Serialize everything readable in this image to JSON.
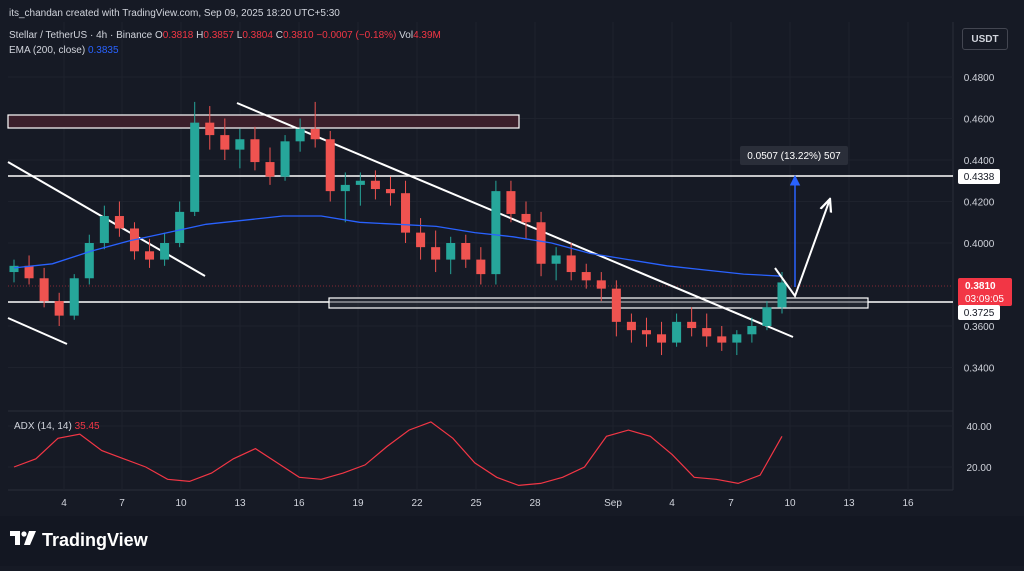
{
  "attribution": "its_chandan created with TradingView.com, Sep 09, 2025 18:20 UTC+5:30",
  "symbol": {
    "name": "Stellar / TetherUS · 4h · Binance",
    "open_label": "O",
    "open": "0.3818",
    "high_label": "H",
    "high": "0.3857",
    "low_label": "L",
    "low": "0.3804",
    "close_label": "C",
    "close": "0.3810",
    "change": "−0.0007 (−0.18%)",
    "vol_label": "Vol",
    "vol": "4.39M"
  },
  "ema": {
    "label": "EMA (200, close)",
    "value": "0.3835"
  },
  "currency_button": "USDT",
  "adx": {
    "label": "ADX (14, 14)",
    "value": "35.45"
  },
  "brand": {
    "logo_text": "TradingView"
  },
  "colors": {
    "background": "#161a25",
    "up": "#26a69a",
    "down": "#ef5350",
    "ema": "#2962ff",
    "adx": "#f23645",
    "white_lines": "#ffffff",
    "resistance_zone": "#3b1f2b"
  },
  "chart_data": {
    "type": "candlestick",
    "y_axis": {
      "ticks": [
        "0.4800",
        "0.4600",
        "0.4400",
        "0.4200",
        "0.4000",
        "0.3600",
        "0.3400"
      ],
      "range": [
        0.33,
        0.49
      ]
    },
    "x_axis": {
      "ticks": [
        "4",
        "7",
        "10",
        "13",
        "16",
        "19",
        "22",
        "25",
        "28",
        "Sep",
        "4",
        "7",
        "10",
        "13",
        "16"
      ]
    },
    "price_labels": {
      "last_price": "0.3810",
      "countdown": "03:09:05",
      "resistance": "0.4338",
      "support": "0.3725"
    },
    "measure": {
      "label": "0.0507 (13.22%) 507",
      "from": 0.381,
      "to": 0.4338
    },
    "levels": [
      0.4338,
      0.3725
    ],
    "resistance_zone": [
      0.4563,
      0.4627
    ],
    "support_zone": [
      0.371,
      0.376
    ],
    "ema_200": [
      0.388,
      0.39,
      0.396,
      0.401,
      0.405,
      0.409,
      0.411,
      0.413,
      0.413,
      0.41,
      0.409,
      0.408,
      0.405,
      0.403,
      0.4,
      0.395,
      0.392,
      0.389,
      0.387,
      0.385,
      0.384
    ],
    "adx_panel": {
      "ticks": [
        "40.00",
        "20.00"
      ],
      "range": [
        10,
        45
      ],
      "values": [
        20,
        24,
        34,
        36,
        28,
        24,
        20,
        14,
        13,
        17,
        24,
        29,
        22,
        15,
        14,
        17,
        21,
        30,
        38,
        42,
        34,
        22,
        15,
        11,
        12,
        15,
        20,
        35,
        38,
        35,
        26,
        15,
        14,
        12,
        16,
        35
      ]
    },
    "candles": [
      [
        0.386,
        0.392,
        0.381,
        0.389
      ],
      [
        0.389,
        0.394,
        0.38,
        0.383
      ],
      [
        0.383,
        0.388,
        0.369,
        0.372
      ],
      [
        0.372,
        0.376,
        0.36,
        0.365
      ],
      [
        0.365,
        0.385,
        0.363,
        0.383
      ],
      [
        0.383,
        0.404,
        0.38,
        0.4
      ],
      [
        0.4,
        0.418,
        0.397,
        0.413
      ],
      [
        0.413,
        0.42,
        0.403,
        0.407
      ],
      [
        0.407,
        0.41,
        0.392,
        0.396
      ],
      [
        0.396,
        0.402,
        0.388,
        0.392
      ],
      [
        0.392,
        0.405,
        0.389,
        0.4
      ],
      [
        0.4,
        0.42,
        0.398,
        0.415
      ],
      [
        0.415,
        0.468,
        0.413,
        0.458
      ],
      [
        0.458,
        0.466,
        0.445,
        0.452
      ],
      [
        0.452,
        0.46,
        0.44,
        0.445
      ],
      [
        0.445,
        0.455,
        0.436,
        0.45
      ],
      [
        0.45,
        0.456,
        0.435,
        0.439
      ],
      [
        0.439,
        0.446,
        0.428,
        0.432
      ],
      [
        0.432,
        0.452,
        0.43,
        0.449
      ],
      [
        0.449,
        0.46,
        0.444,
        0.455
      ],
      [
        0.455,
        0.468,
        0.446,
        0.45
      ],
      [
        0.45,
        0.454,
        0.42,
        0.425
      ],
      [
        0.425,
        0.434,
        0.41,
        0.428
      ],
      [
        0.428,
        0.434,
        0.418,
        0.43
      ],
      [
        0.43,
        0.435,
        0.421,
        0.426
      ],
      [
        0.426,
        0.432,
        0.418,
        0.424
      ],
      [
        0.424,
        0.43,
        0.4,
        0.405
      ],
      [
        0.405,
        0.412,
        0.392,
        0.398
      ],
      [
        0.398,
        0.406,
        0.386,
        0.392
      ],
      [
        0.392,
        0.403,
        0.385,
        0.4
      ],
      [
        0.4,
        0.404,
        0.388,
        0.392
      ],
      [
        0.392,
        0.398,
        0.38,
        0.385
      ],
      [
        0.385,
        0.43,
        0.38,
        0.425
      ],
      [
        0.425,
        0.43,
        0.41,
        0.414
      ],
      [
        0.414,
        0.42,
        0.402,
        0.41
      ],
      [
        0.41,
        0.415,
        0.384,
        0.39
      ],
      [
        0.39,
        0.398,
        0.382,
        0.394
      ],
      [
        0.394,
        0.4,
        0.382,
        0.386
      ],
      [
        0.386,
        0.39,
        0.378,
        0.382
      ],
      [
        0.382,
        0.386,
        0.372,
        0.378
      ],
      [
        0.378,
        0.382,
        0.355,
        0.362
      ],
      [
        0.362,
        0.366,
        0.352,
        0.358
      ],
      [
        0.358,
        0.364,
        0.35,
        0.356
      ],
      [
        0.356,
        0.362,
        0.346,
        0.352
      ],
      [
        0.352,
        0.366,
        0.35,
        0.362
      ],
      [
        0.362,
        0.369,
        0.355,
        0.359
      ],
      [
        0.359,
        0.366,
        0.35,
        0.355
      ],
      [
        0.355,
        0.36,
        0.348,
        0.352
      ],
      [
        0.352,
        0.358,
        0.346,
        0.356
      ],
      [
        0.356,
        0.364,
        0.352,
        0.36
      ],
      [
        0.36,
        0.372,
        0.358,
        0.369
      ],
      [
        0.369,
        0.386,
        0.366,
        0.381
      ]
    ]
  }
}
